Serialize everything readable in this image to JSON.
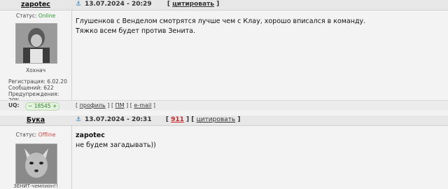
{
  "posts": [
    {
      "username": "zapotec",
      "datetime": "13.07.2024 - 20:29",
      "quote_label": "цитировать",
      "status_label": "Статус:",
      "status": "Online",
      "avatar_caption": "Хохнач",
      "reg_label": "Регистрация:",
      "reg_value": "6.02.20",
      "msgs_label": "Сообщений:",
      "msgs_value": "622",
      "warn_label": "Предупреждения:",
      "warn_value": "20%",
      "lines": [
        "Глушенков с Венделом смотрятся лучше чем с Клау, хорошо вписался в команду.",
        "Тяжко всем будет против Зенита."
      ],
      "uq_label": "UQ:",
      "rep_value": "18545",
      "profile_label": "профиль",
      "pm_label": "ПМ",
      "email_label": "e-mail"
    },
    {
      "username": "Бука",
      "datetime": "13.07.2024 - 20:31",
      "count": "911",
      "quote_label": "цитировать",
      "status_label": "Статус:",
      "status": "Offline",
      "avatar_caption": "ЗЕНИТ-чемпион!!",
      "quoted_user": "zapotec",
      "line": "не будем загадывать))"
    }
  ],
  "colors": {
    "online": "#2e9b2e",
    "offline": "#d04a4a",
    "anchor": "#2a7bb5"
  }
}
